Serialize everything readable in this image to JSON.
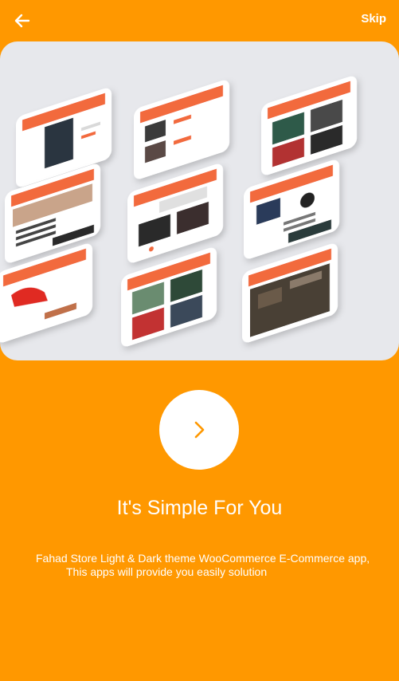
{
  "topbar": {
    "back_icon": "arrow-left-icon",
    "skip_label": "Skip"
  },
  "hero": {
    "image": "app-screens-mockup",
    "phone_header_color": "#F26A3D"
  },
  "next_button": {
    "icon": "chevron-right-icon"
  },
  "content": {
    "title": "It's Simple For You",
    "description_line1": "Fahad Store Light & Dark theme WooCommerce E-Commerce app,",
    "description_line2": "This apps will provide you easily solution"
  },
  "colors": {
    "background": "#FF9800",
    "text": "#FFFFFF",
    "button_bg": "#FFFFFF",
    "chevron": "#FF9800",
    "hero_bg": "#E7E8EC"
  }
}
